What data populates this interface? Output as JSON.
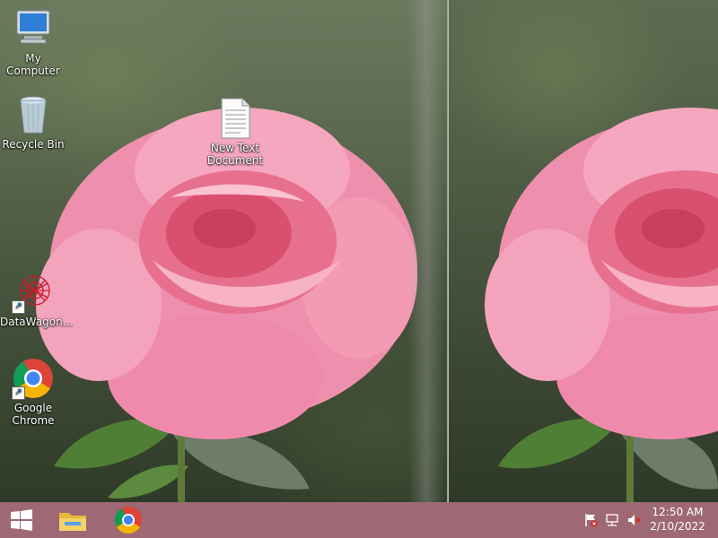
{
  "desktop": {
    "icons": [
      {
        "label_line1": "My",
        "label_line2": "Computer",
        "icon": "computer-icon"
      },
      {
        "label_line1": "Recycle Bin",
        "label_line2": "",
        "icon": "recycle-bin-icon"
      },
      {
        "label_line1": "New Text",
        "label_line2": "Document",
        "icon": "text-document-icon"
      },
      {
        "label_line1": "DataWagon...",
        "label_line2": "",
        "icon": "datawagon-icon"
      },
      {
        "label_line1": "Google",
        "label_line2": "Chrome",
        "icon": "chrome-icon"
      }
    ]
  },
  "taskbar": {
    "start_icon": "windows-start-icon",
    "pinned": [
      "file-explorer-icon",
      "chrome-icon"
    ],
    "tray": [
      "action-center-flag-icon",
      "network-icon",
      "volume-muted-icon"
    ],
    "clock": {
      "time": "12:50 AM",
      "date": "2/10/2022"
    },
    "color": "#965c68"
  }
}
